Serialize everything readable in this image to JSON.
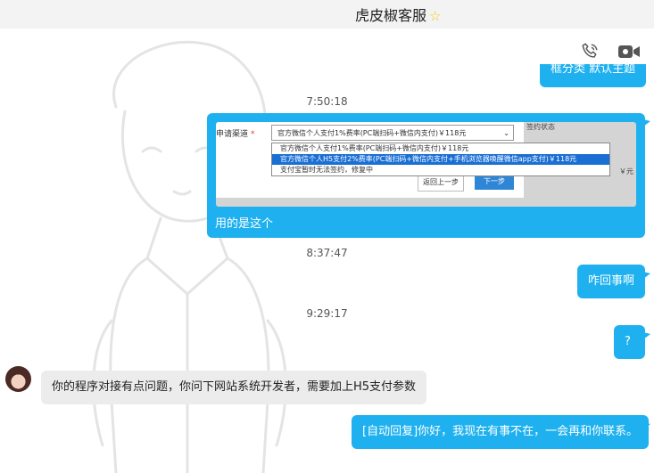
{
  "header": {
    "title": "虎皮椒客服"
  },
  "messages": {
    "partial_top": "框分类 默认主题",
    "ts1": "7:50:18",
    "shot": {
      "label": "申请渠道",
      "required_mark": "*",
      "selected": "官方微信个人支付1%费率(PC端扫码+微信内支付)￥118元",
      "options": [
        "官方微信个人支付1%费率(PC端扫码+微信内支付)￥118元",
        "官方微信个人H5支付2%费率(PC端扫码+微信内支付+手机浏览器唤醒微信app支付)￥118元",
        "支付宝暂时无法签约，修复中"
      ],
      "back_button": "返回上一步",
      "next_button": "下一步",
      "right_header": "签约状态",
      "right_text": "￥元"
    },
    "caption": "用的是这个",
    "ts2": "8:37:47",
    "m1": "咋回事啊",
    "ts3": "9:29:17",
    "m2": "?",
    "m3": "你的程序对接有点问题，你问下网站系统开发者，需要加上H5支付参数",
    "m4": "[自动回复]你好，我现在有事不在，一会再和你联系。"
  }
}
